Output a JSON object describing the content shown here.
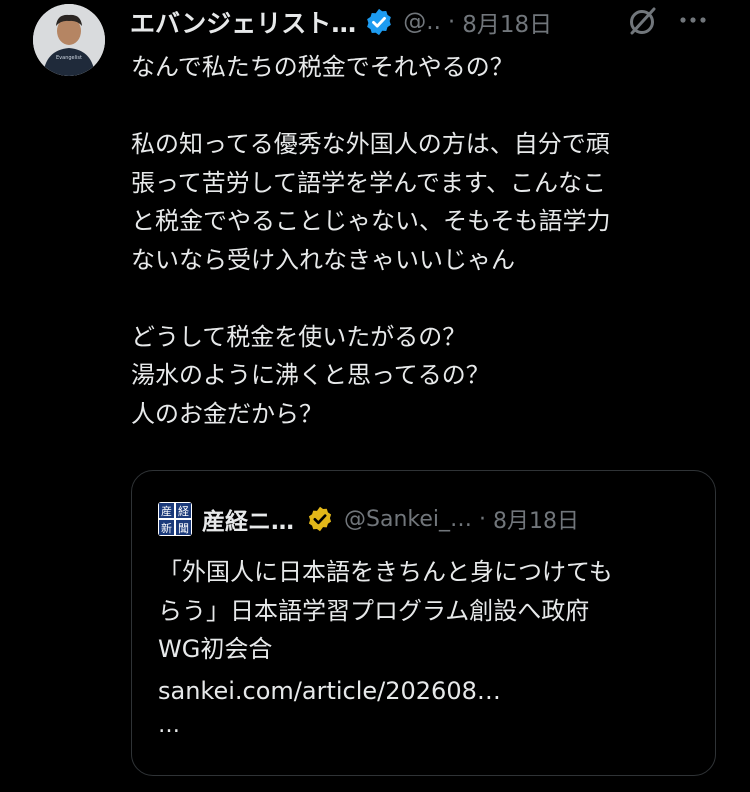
{
  "tweet": {
    "author": {
      "display_name": "エバンジェリスト…",
      "handle": "@..",
      "verified": true,
      "avatar_shirt_text": "Evangelist"
    },
    "separator": "·",
    "time": "8月18日",
    "icons": {
      "grok": "grok-slash-icon",
      "more": "more-horizontal-icon"
    },
    "text": "なんで私たちの税金でそれやるの？\n\n私の知ってる優秀な外国人の方は、自分で頑\n張って苦労して語学を学んでます、こんなこ\nと税金でやることじゃない、そもそも語学力\nないなら受け入れなきゃいいじゃん\n\nどうして税金を使いたがるの？\n湯水のように沸くと思ってるの？\n人のお金だから？",
    "quoted": {
      "author": {
        "display_name": "産経ニ…",
        "handle": "@Sankei_…",
        "verified_gold": true,
        "logo_chars": [
          "産",
          "経",
          "新",
          "聞"
        ]
      },
      "time": "8月18日",
      "text": "「外国人に日本語をきちんと身につけても\nらう」日本語学習プログラム創設へ政府\nWG初会合",
      "link": "sankei.com/article/202608…",
      "more": "…"
    }
  },
  "colors": {
    "background": "#000000",
    "text": "#e7e9ea",
    "secondary": "#71767b",
    "verified_blue": "#1d9bf0",
    "verified_gold": "#e2b719",
    "border": "#2f3336"
  }
}
